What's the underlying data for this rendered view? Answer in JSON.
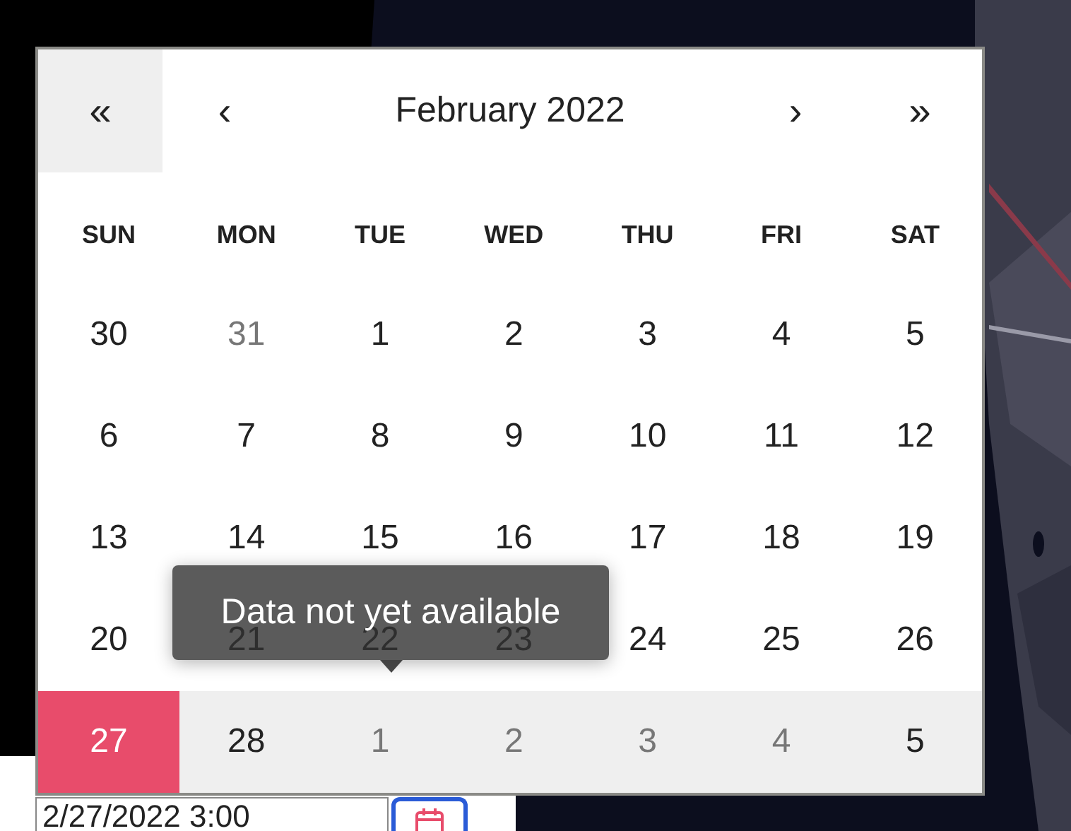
{
  "calendar": {
    "nav": [
      {
        "label": "«",
        "kind": "prev-year",
        "hovered": true
      },
      {
        "label": "‹",
        "kind": "prev-month",
        "hovered": false
      },
      {
        "label": "›",
        "kind": "next-month",
        "hovered": false
      },
      {
        "label": "»",
        "kind": "next-year",
        "hovered": false
      }
    ],
    "title": "February 2022",
    "weekdays": [
      "SUN",
      "MON",
      "TUE",
      "WED",
      "THU",
      "FRI",
      "SAT"
    ],
    "weeks": [
      {
        "highlighted": false,
        "days": [
          {
            "label": "30",
            "selected": false
          },
          {
            "label": "31",
            "muted": true,
            "selected": false
          },
          {
            "label": "1",
            "selected": false
          },
          {
            "label": "2",
            "selected": false
          },
          {
            "label": "3",
            "selected": false
          },
          {
            "label": "4",
            "selected": false
          },
          {
            "label": "5",
            "selected": false
          }
        ]
      },
      {
        "highlighted": false,
        "days": [
          {
            "label": "6",
            "selected": false
          },
          {
            "label": "7",
            "selected": false
          },
          {
            "label": "8",
            "selected": false
          },
          {
            "label": "9",
            "selected": false
          },
          {
            "label": "10",
            "selected": false
          },
          {
            "label": "11",
            "selected": false
          },
          {
            "label": "12",
            "selected": false
          }
        ]
      },
      {
        "highlighted": false,
        "days": [
          {
            "label": "13",
            "selected": false
          },
          {
            "label": "14",
            "selected": false
          },
          {
            "label": "15",
            "selected": false
          },
          {
            "label": "16",
            "selected": false
          },
          {
            "label": "17",
            "selected": false
          },
          {
            "label": "18",
            "selected": false
          },
          {
            "label": "19",
            "selected": false
          }
        ]
      },
      {
        "highlighted": false,
        "days": [
          {
            "label": "20",
            "selected": false
          },
          {
            "label": "21",
            "selected": false
          },
          {
            "label": "22",
            "selected": false
          },
          {
            "label": "23",
            "selected": false
          },
          {
            "label": "24",
            "selected": false
          },
          {
            "label": "25",
            "selected": false
          },
          {
            "label": "26",
            "selected": false
          }
        ]
      },
      {
        "highlighted": true,
        "days": [
          {
            "label": "27",
            "selected": true
          },
          {
            "label": "28",
            "selected": false
          },
          {
            "label": "1",
            "muted": true,
            "selected": false
          },
          {
            "label": "2",
            "muted": true,
            "selected": false
          },
          {
            "label": "3",
            "muted": true,
            "selected": false
          },
          {
            "label": "4",
            "muted": true,
            "selected": false
          },
          {
            "label": "5",
            "selected": false
          }
        ]
      }
    ],
    "tooltip": {
      "text": "Data not yet available"
    }
  },
  "date_input": {
    "value": "2/27/2022 3:00"
  }
}
